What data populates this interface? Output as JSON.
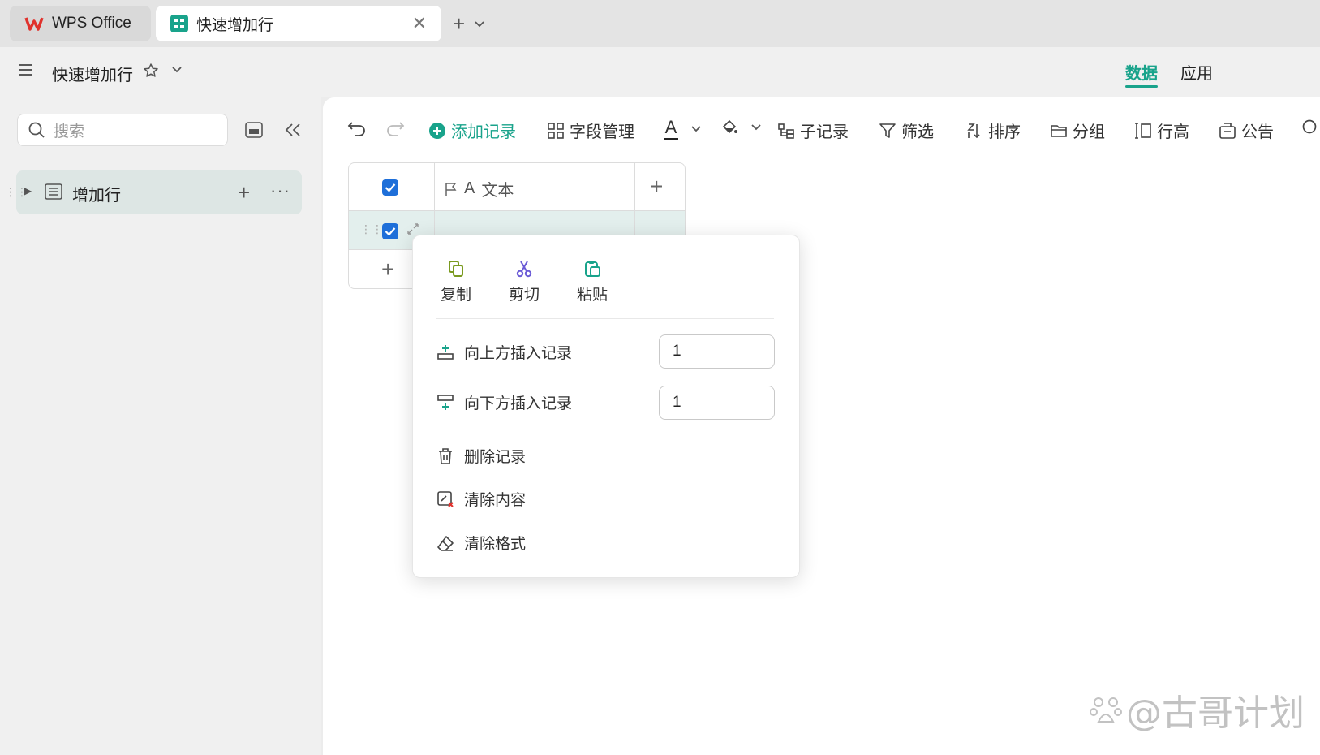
{
  "tabs": {
    "wps_label": "WPS Office",
    "doc_label": "快速增加行"
  },
  "header": {
    "title": "快速增加行",
    "right_tabs": [
      "数据",
      "应用"
    ]
  },
  "sidebar": {
    "search_placeholder": "搜索",
    "items": [
      {
        "label": "增加行"
      }
    ]
  },
  "toolbar": {
    "add_record": "添加记录",
    "field_manage": "字段管理",
    "font_glyph": "A",
    "sub_record": "子记录",
    "filter": "筛选",
    "sort": "排序",
    "group": "分组",
    "row_height": "行高",
    "notice": "公告"
  },
  "grid": {
    "columns": [
      {
        "label": "文本",
        "type_glyph": "A"
      }
    ]
  },
  "context_menu": {
    "quick_actions": [
      {
        "label": "复制",
        "icon": "copy-icon",
        "color": "#7a9a1f"
      },
      {
        "label": "剪切",
        "icon": "scissors-icon",
        "color": "#6b5bd6"
      },
      {
        "label": "粘贴",
        "icon": "paste-icon",
        "color": "#19a38b"
      }
    ],
    "insert_above": {
      "label": "向上方插入记录",
      "value": "1"
    },
    "insert_below": {
      "label": "向下方插入记录",
      "value": "1"
    },
    "delete": "删除记录",
    "clear_content": "清除内容",
    "clear_format": "清除格式"
  },
  "watermark": "@古哥计划",
  "colors": {
    "accent": "#19a38b",
    "checkbox": "#1e6fd9",
    "selected_row": "#e3efed"
  }
}
